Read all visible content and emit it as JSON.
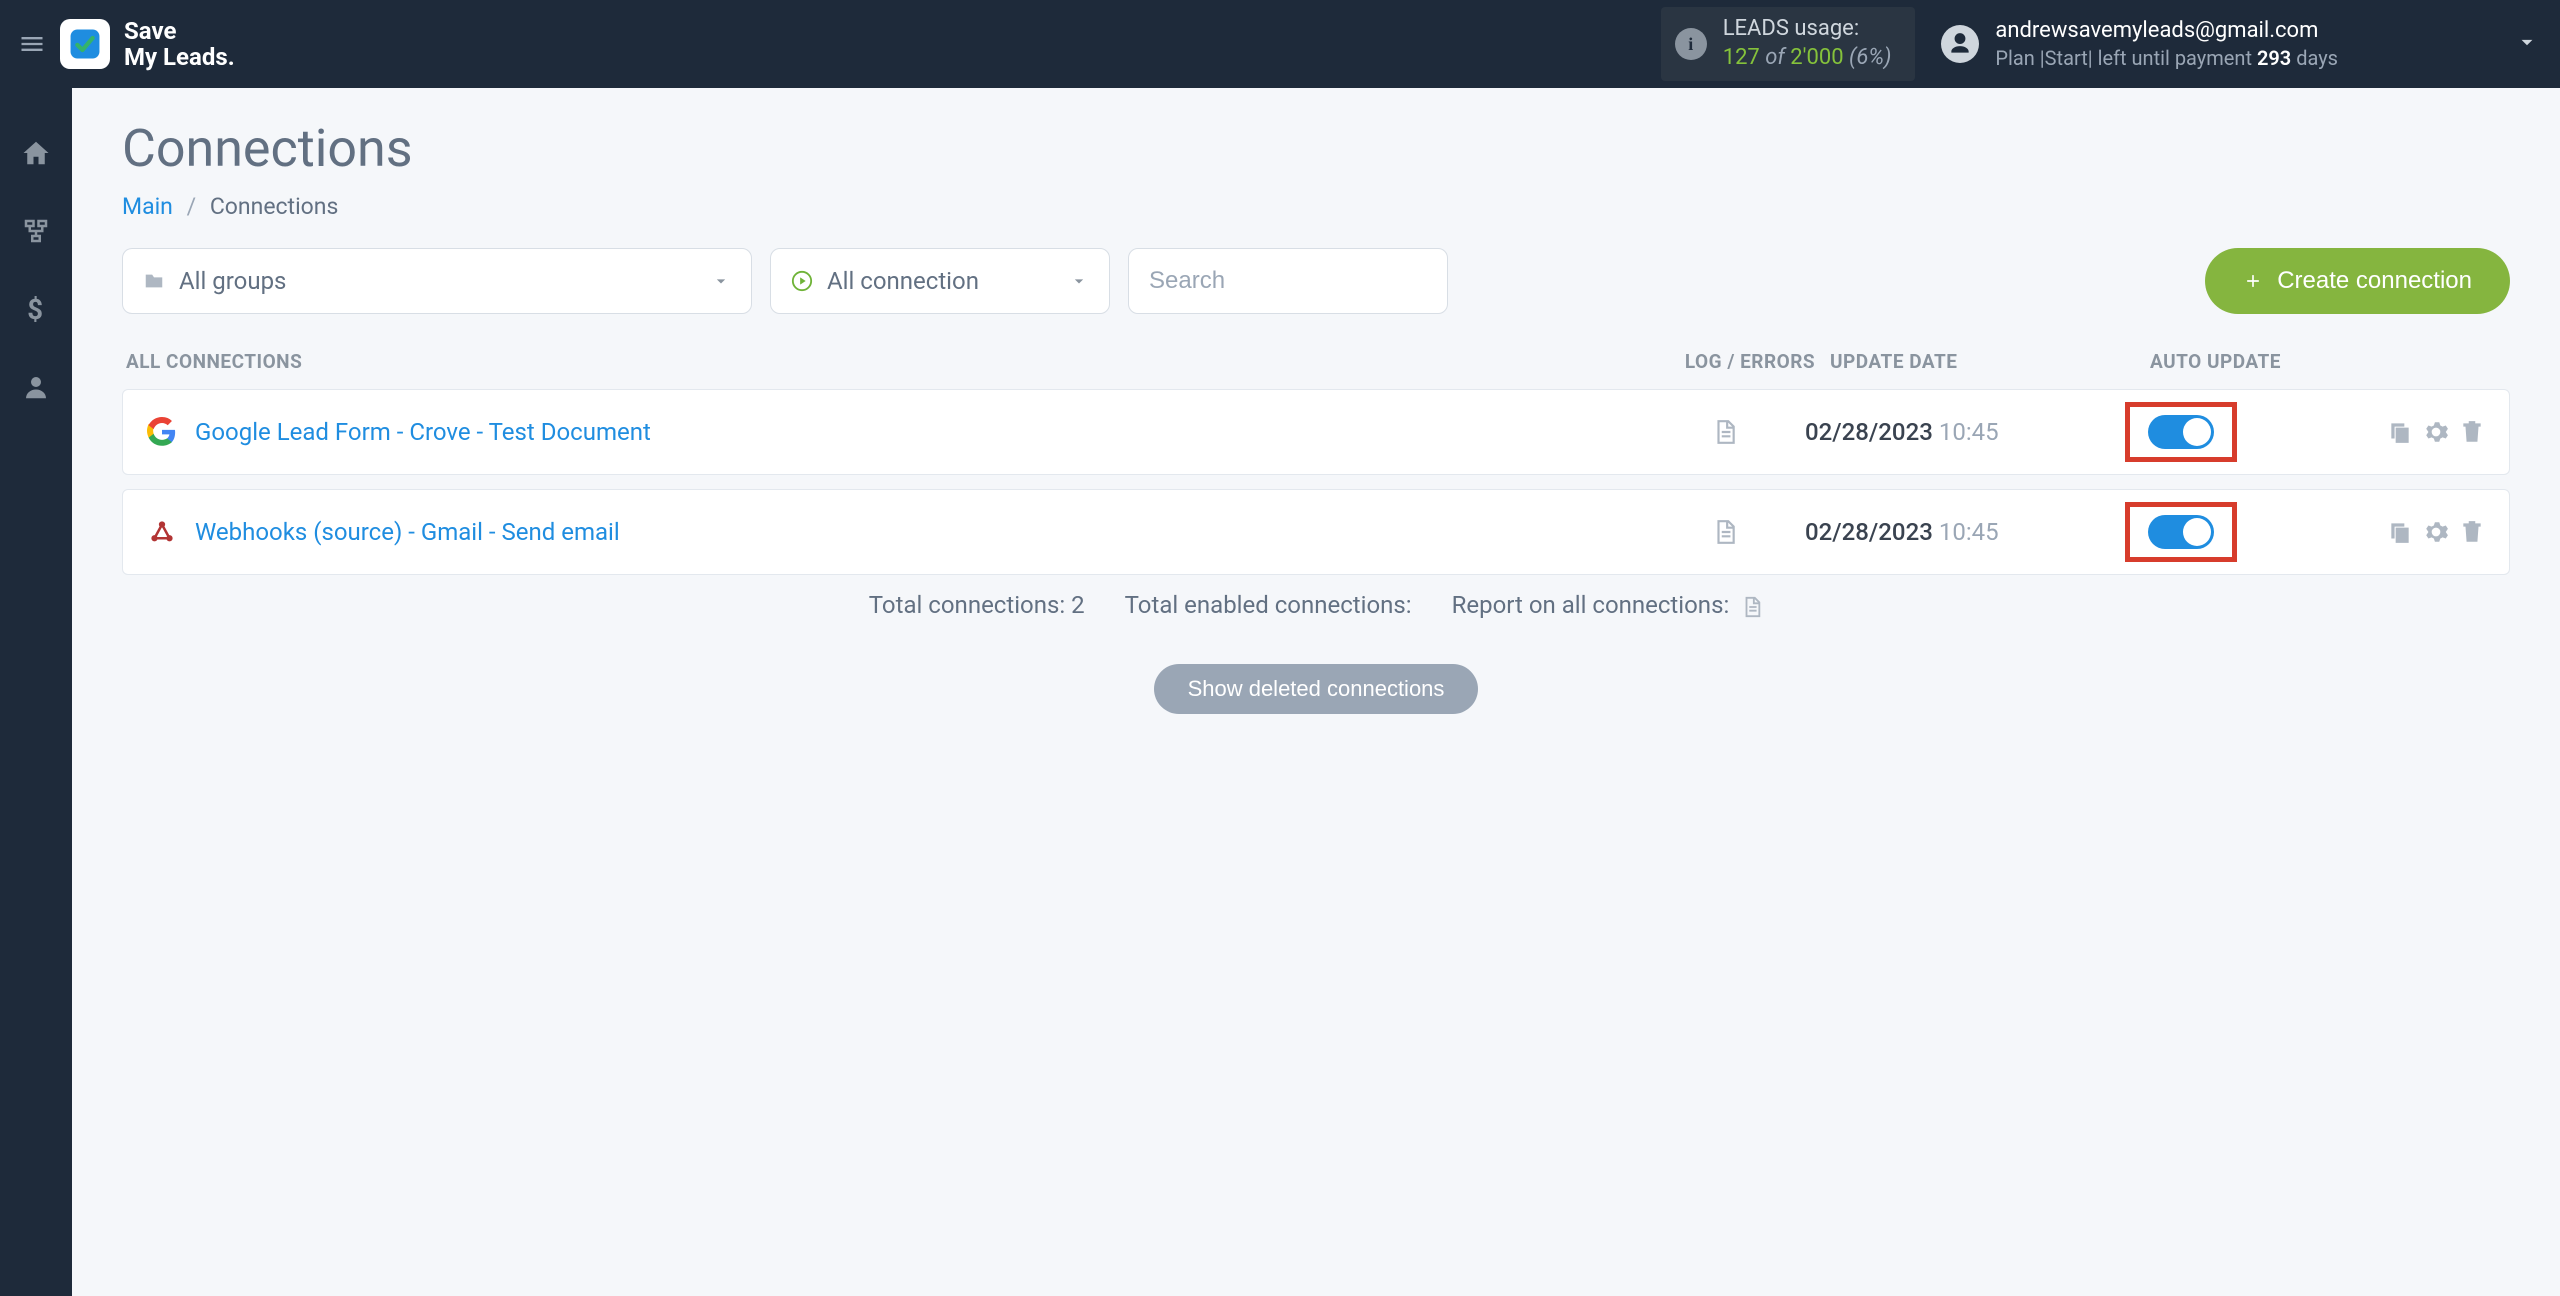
{
  "brand": {
    "line1": "Save",
    "line2": "My Leads."
  },
  "usage": {
    "label": "LEADS usage:",
    "used": "127",
    "of": "of",
    "total": "2'000",
    "pct": "(6%)"
  },
  "account": {
    "email": "andrewsavemyleads@gmail.com",
    "plan_prefix": "Plan |Start| left until payment ",
    "days": "293",
    "days_suffix": " days"
  },
  "page": {
    "title": "Connections"
  },
  "breadcrumb": {
    "main": "Main",
    "current": "Connections"
  },
  "filters": {
    "groups": "All groups",
    "connection": "All connection",
    "search_placeholder": "Search"
  },
  "buttons": {
    "create": "Create connection",
    "show_deleted": "Show deleted connections"
  },
  "headers": {
    "all": "ALL CONNECTIONS",
    "log": "LOG / ERRORS",
    "date": "UPDATE DATE",
    "auto": "AUTO UPDATE"
  },
  "rows": [
    {
      "icon": "google",
      "name": "Google Lead Form - Crove - Test Document",
      "date": "02/28/2023",
      "time": "10:45",
      "auto": true
    },
    {
      "icon": "webhook",
      "name": "Webhooks (source) - Gmail - Send email",
      "date": "02/28/2023",
      "time": "10:45",
      "auto": true
    }
  ],
  "summary": {
    "total": "Total connections: 2",
    "enabled": "Total enabled connections:",
    "report": "Report on all connections:"
  }
}
